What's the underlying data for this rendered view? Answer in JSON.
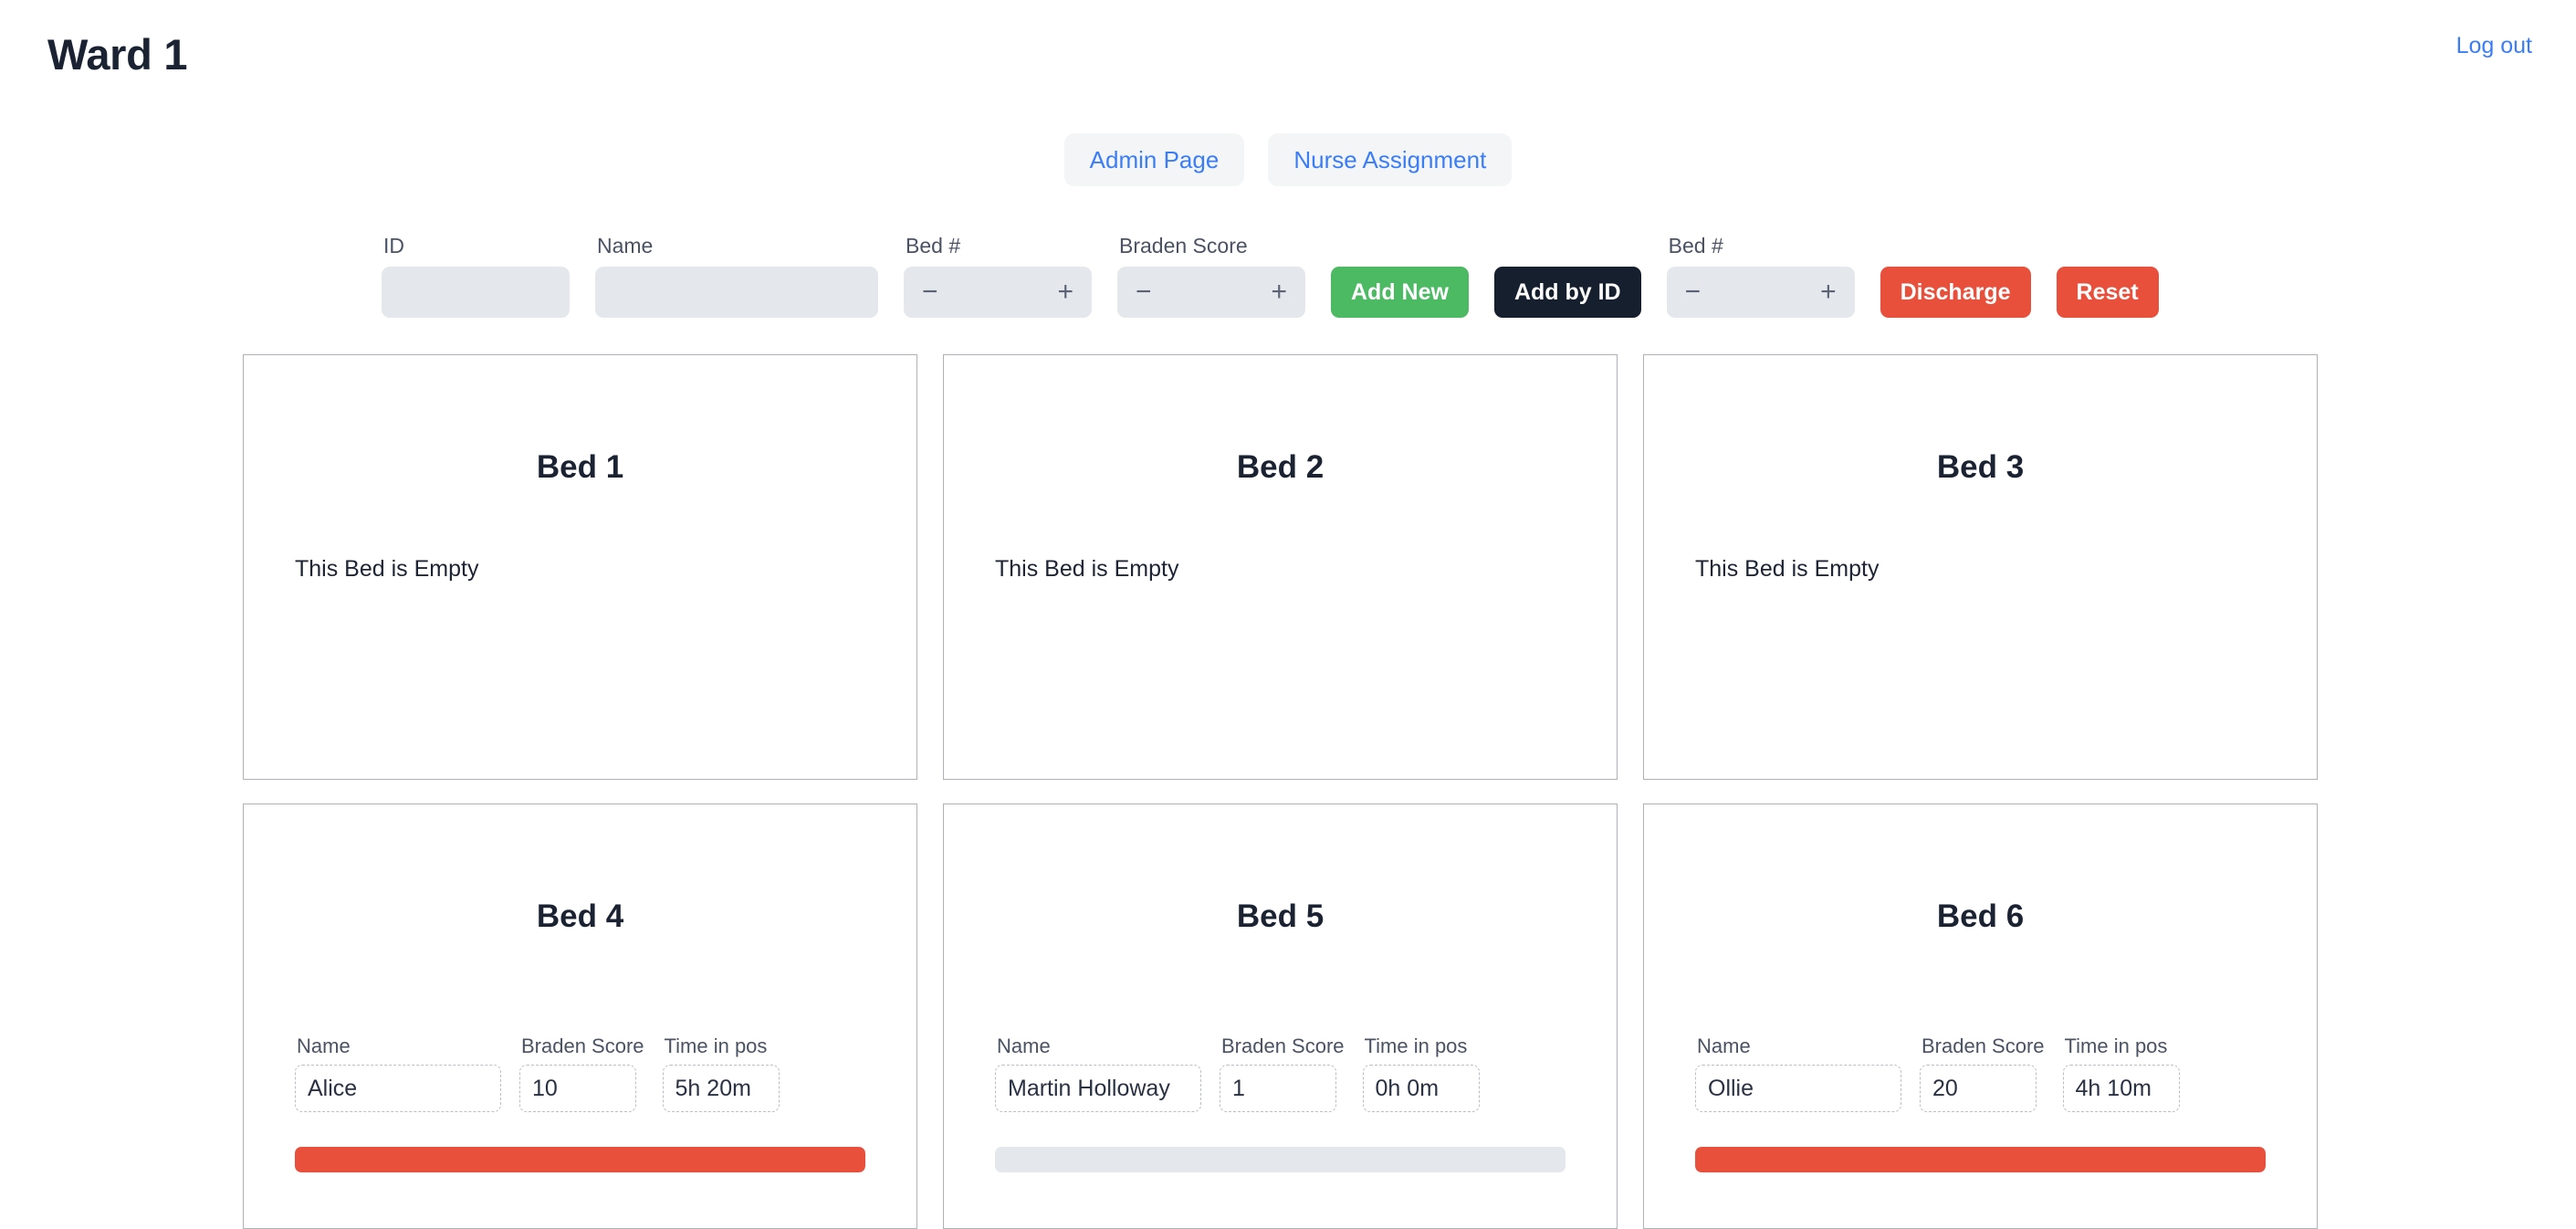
{
  "header": {
    "title": "Ward 1",
    "logout_label": "Log out"
  },
  "nav": {
    "items": [
      {
        "label": "Admin Page",
        "name": "admin-page"
      },
      {
        "label": "Nurse Assignment",
        "name": "nurse-assignment"
      }
    ]
  },
  "toolbar": {
    "id_label": "ID",
    "id_value": "",
    "id_placeholder": "",
    "name_label": "Name",
    "name_value": "",
    "name_placeholder": "",
    "bed_label_1": "Bed #",
    "bed_value_1": "",
    "braden_label": "Braden Score",
    "braden_value": "",
    "bed_label_2": "Bed #",
    "bed_value_2": "",
    "minus_glyph": "−",
    "plus_glyph": "+",
    "add_new_label": "Add New",
    "add_by_id_label": "Add by ID",
    "discharge_label": "Discharge",
    "reset_label": "Reset"
  },
  "labels": {
    "name": "Name",
    "braden": "Braden Score",
    "time_in_pos": "Time in pos",
    "empty_text": "This Bed is Empty"
  },
  "colors": {
    "accent_blue": "#3b7df6",
    "green": "#4cb963",
    "dark": "#161f2d",
    "red": "#e8503c",
    "input_bg": "#e4e8ec",
    "track": "#e4e8ec"
  },
  "beds": [
    {
      "title": "Bed 1",
      "occupied": false,
      "empty_text": "This Bed is Empty"
    },
    {
      "title": "Bed 2",
      "occupied": false,
      "empty_text": "This Bed is Empty"
    },
    {
      "title": "Bed 3",
      "occupied": false,
      "empty_text": "This Bed is Empty"
    },
    {
      "title": "Bed 4",
      "occupied": true,
      "patient_name": "Alice",
      "braden_score": "10",
      "time_in_pos": "5h 20m",
      "progress_percent": 100,
      "progress_color": "#e8503c"
    },
    {
      "title": "Bed 5",
      "occupied": true,
      "patient_name": "Martin Holloway",
      "braden_score": "1",
      "time_in_pos": "0h 0m",
      "progress_percent": 0,
      "progress_color": "#e8503c"
    },
    {
      "title": "Bed 6",
      "occupied": true,
      "patient_name": "Ollie",
      "braden_score": "20",
      "time_in_pos": "4h 10m",
      "progress_percent": 100,
      "progress_color": "#e8503c"
    }
  ]
}
